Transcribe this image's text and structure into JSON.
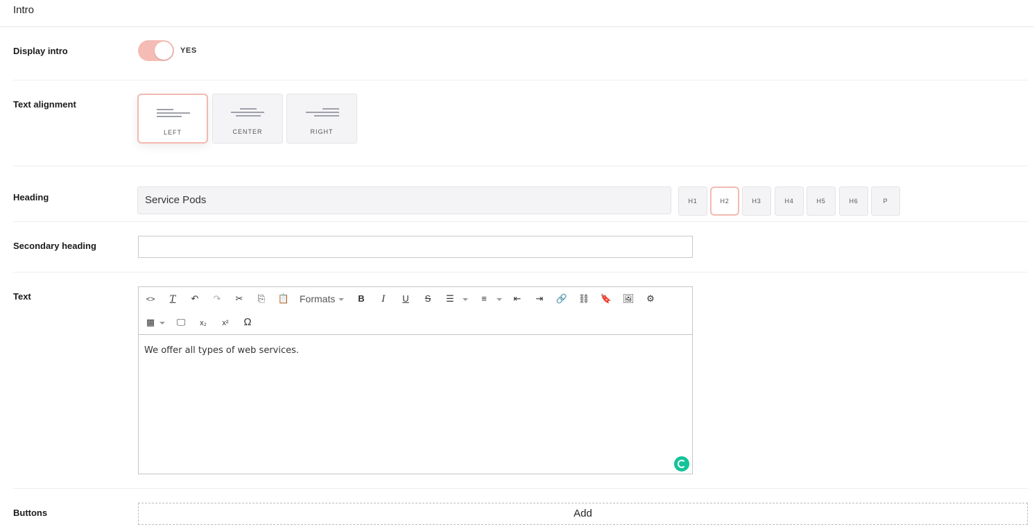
{
  "section": {
    "title": "Intro"
  },
  "display_intro": {
    "label": "Display intro",
    "state_text": "YES",
    "accent": "#f4bcb4"
  },
  "text_alignment": {
    "label": "Text alignment",
    "options": [
      "LEFT",
      "CENTER",
      "RIGHT"
    ],
    "selected": "LEFT"
  },
  "heading": {
    "label": "Heading",
    "value": "Service Pods",
    "levels": [
      "H1",
      "H2",
      "H3",
      "H4",
      "H5",
      "H6",
      "P"
    ],
    "selected_level": "H2"
  },
  "secondary_heading": {
    "label": "Secondary heading",
    "value": ""
  },
  "text": {
    "label": "Text",
    "toolbar": {
      "formats_label": "Formats",
      "icons": [
        "source-code-icon",
        "clear-formatting-icon",
        "undo-icon",
        "redo-icon",
        "cut-icon",
        "copy-icon",
        "paste-icon",
        "bold-icon",
        "italic-icon",
        "underline-icon",
        "strikethrough-icon",
        "bullet-list-icon",
        "numbered-list-icon",
        "outdent-icon",
        "indent-icon",
        "link-icon",
        "unlink-icon",
        "bookmark-icon",
        "image-icon",
        "settings-icon",
        "table-icon",
        "preview-icon",
        "subscript-icon",
        "superscript-icon",
        "special-character-icon"
      ]
    },
    "content": "We offer all types of web services."
  },
  "buttons": {
    "label": "Buttons",
    "add_label": "Add"
  }
}
